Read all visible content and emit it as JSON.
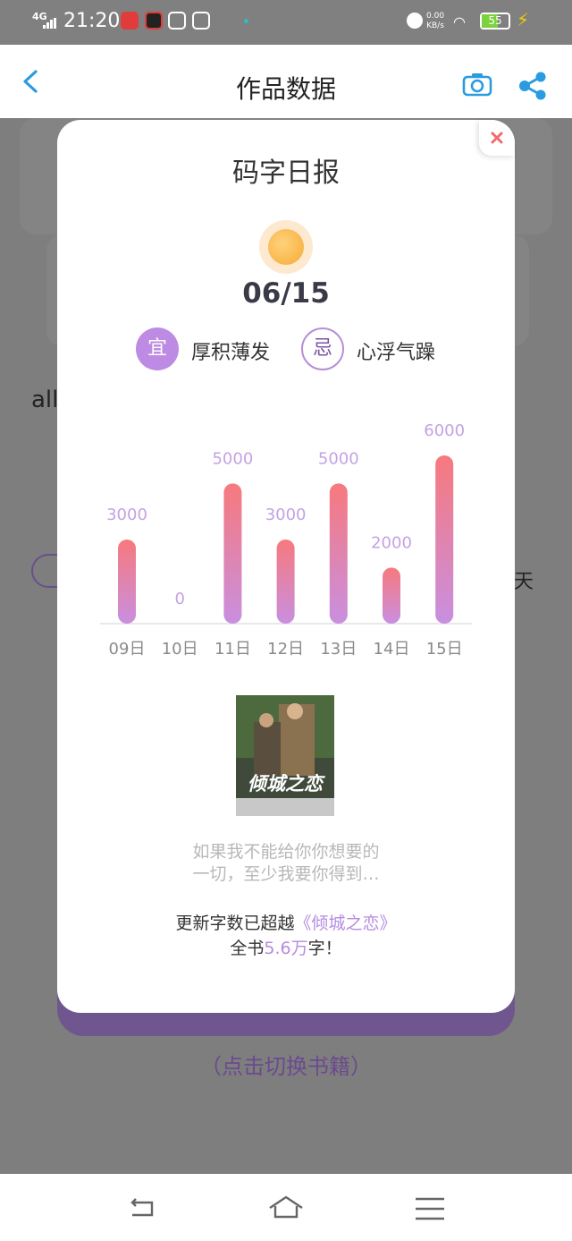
{
  "status_bar": {
    "network": "4G",
    "time": "21:20",
    "net_speed_value": "0.00",
    "net_speed_unit": "KB/s",
    "battery": "55",
    "icons": [
      "signal-icon",
      "app-icon-red",
      "app-icon-black",
      "app-icon-a",
      "app-icon-card",
      "alarm-icon",
      "wifi-icon",
      "battery-icon",
      "charging-icon"
    ]
  },
  "header": {
    "title": "作品数据",
    "icons": [
      "back-arrow-icon",
      "camera-icon",
      "share-icon"
    ]
  },
  "background": {
    "text": "all",
    "day_text": "天",
    "switch_link": "（点击切换书籍）"
  },
  "modal": {
    "title": "码字日报",
    "date": "06/15",
    "yi_label": "宜",
    "yi_text": "厚积薄发",
    "ji_label": "忌",
    "ji_text": "心浮气躁",
    "quote_line1": "如果我不能给你你想要的",
    "quote_line2": "一切，至少我要你得到…",
    "summary_prefix": "更新字数已超越",
    "summary_book": "《倾城之恋》",
    "summary_line2_prefix": "全书",
    "summary_words": "5.6万",
    "summary_line2_suffix": "字！",
    "poster_title": "倾城之恋",
    "close_icon": "close-icon"
  },
  "chart_data": {
    "type": "bar",
    "categories": [
      "09日",
      "10日",
      "11日",
      "12日",
      "13日",
      "14日",
      "15日"
    ],
    "values": [
      3000,
      0,
      5000,
      3000,
      5000,
      2000,
      6000
    ],
    "value_labels": [
      "3000",
      "0",
      "5000",
      "3000",
      "5000",
      "2000",
      "6000"
    ],
    "ylim": [
      0,
      6000
    ],
    "grid": false,
    "colors": {
      "bar_top": "#f7797d",
      "bar_bottom": "#c98fe0",
      "label": "#c5a2e4",
      "tick": "#8a8a8a",
      "baseline": "#e2e2e2"
    }
  },
  "navbar": {
    "icons": [
      "back-nav-icon",
      "home-nav-icon",
      "menu-nav-icon"
    ]
  }
}
